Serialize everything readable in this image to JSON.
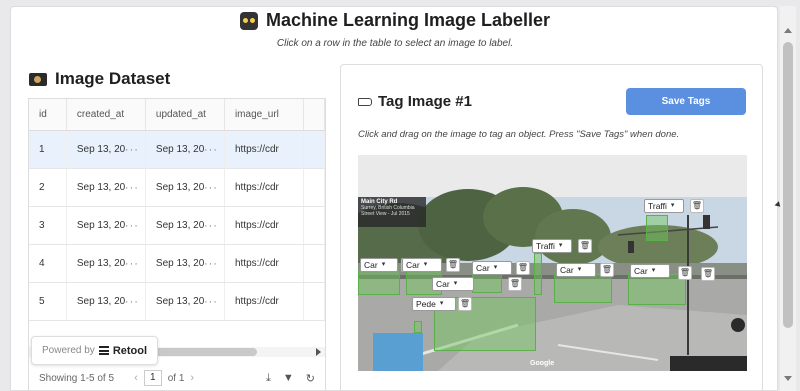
{
  "header": {
    "title": "Machine Learning Image Labeller",
    "subtitle": "Click on a row in the table to select an image to label."
  },
  "dataset": {
    "title": "Image Dataset",
    "columns": [
      "id",
      "created_at",
      "updated_at",
      "image_url",
      ""
    ],
    "rows": [
      {
        "id": "1",
        "created_at": "Sep 13, 20",
        "updated_at": "Sep 13, 20",
        "image_url": "https://cdr"
      },
      {
        "id": "2",
        "created_at": "Sep 13, 20",
        "updated_at": "Sep 13, 20",
        "image_url": "https://cdr"
      },
      {
        "id": "3",
        "created_at": "Sep 13, 20",
        "updated_at": "Sep 13, 20",
        "image_url": "https://cdr"
      },
      {
        "id": "4",
        "created_at": "Sep 13, 20",
        "updated_at": "Sep 13, 20",
        "image_url": "https://cdr"
      },
      {
        "id": "5",
        "created_at": "Sep 13, 20",
        "updated_at": "Sep 13, 20",
        "image_url": "https://cdr"
      }
    ],
    "selected_row": 0,
    "footer": {
      "showing": "Showing 1-5 of 5",
      "page": "1",
      "of": "of 1"
    }
  },
  "powered_by": {
    "label": "Powered by",
    "brand": "Retool"
  },
  "tag_panel": {
    "title": "Tag Image #1",
    "save_label": "Save Tags",
    "instructions": "Click and drag on the image to tag an object. Press \"Save Tags\" when done.",
    "map_overlay": {
      "street": "Main City Rd",
      "region": "Surrey, British Columbia",
      "caption": "Street View - Jul 2015"
    },
    "watermark": "Google",
    "tags": [
      {
        "label": "Traffi"
      },
      {
        "label": "Traffi"
      },
      {
        "label": "Car"
      },
      {
        "label": "Car"
      },
      {
        "label": "Car"
      },
      {
        "label": "Car"
      },
      {
        "label": "Car"
      },
      {
        "label": "Car"
      },
      {
        "label": "Pede"
      }
    ]
  },
  "colors": {
    "accent": "#5b8fe0",
    "bbox_fill": "#6ec85a",
    "selected_row": "#e9f1fc"
  }
}
